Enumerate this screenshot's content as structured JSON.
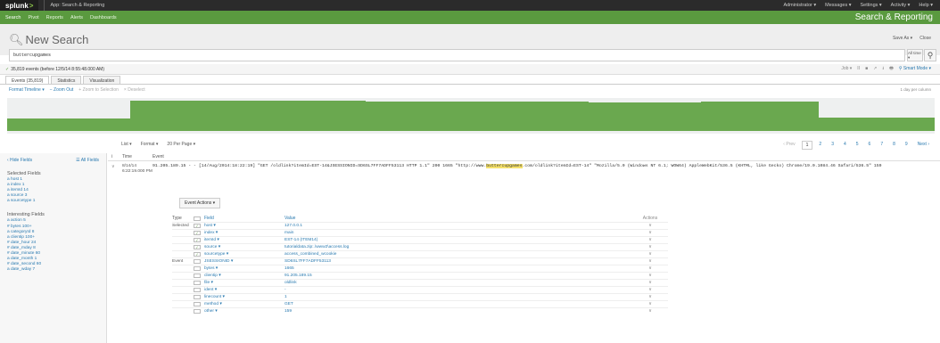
{
  "topbar": {
    "logo": "splunk",
    "app_name": "App: Search & Reporting",
    "right_items": [
      "Administrator ▾",
      "Messages ▾",
      "Settings ▾",
      "Activity ▾",
      "Help ▾"
    ]
  },
  "nav": {
    "items": [
      "Search",
      "Pivot",
      "Reports",
      "Alerts",
      "Dashboards"
    ],
    "title": "Search & Reporting"
  },
  "page": {
    "title": "New Search",
    "buttons": [
      "Save As ▾",
      "Close"
    ]
  },
  "search": {
    "query": "buttercupgames",
    "time_picker": "All time ▾"
  },
  "status": {
    "text": "35,819 events (before 12/5/14 8:55:48.000 AM)",
    "right": [
      "Job ▾",
      "II",
      "■",
      "↗",
      "⭳",
      "🖶"
    ],
    "mode": "⚲ Smart Mode ▾"
  },
  "tabs": [
    "Events (35,819)",
    "Statistics",
    "Visualization"
  ],
  "timeline_tools": {
    "format": "Format Timeline ▾",
    "zoom_out": "− Zoom Out",
    "zoom_sel": "+ Zoom to Selection",
    "deselect": "× Deselect",
    "scale": "1 day per column"
  },
  "list_options": [
    "List ▾",
    "Format ▾",
    "20 Per Page ▾"
  ],
  "pagination": {
    "prev": "‹ Prev",
    "pages": [
      "1",
      "2",
      "3",
      "4",
      "5",
      "6",
      "7",
      "8",
      "9"
    ],
    "next": "Next ›"
  },
  "sidebar": {
    "hide": "‹ Hide Fields",
    "all": "☰ All Fields",
    "selected_title": "Selected Fields",
    "selected": [
      "a host 1",
      "a index 1",
      "a itemId 14",
      "a source 3",
      "a sourcetype 1"
    ],
    "interesting_title": "Interesting Fields",
    "interesting": [
      "a action 5",
      "# bytes 100+",
      "a categoryId 8",
      "a clientip 100+",
      "# date_hour 24",
      "# date_mday 8",
      "# date_minute 60",
      "a date_month 1",
      "# date_second 60",
      "a date_wday 7"
    ]
  },
  "results": {
    "col_i": "i",
    "col_time": "Time",
    "col_event": "Event",
    "time_date": "8/14/14",
    "time_clock": "6:22:19.000 PM",
    "raw_pre": "91.205.189.15 - - [14/Aug/2014:18:22:19] \"GET /oldlink?itemId=EST-14&JSESSIONID=SD6SL7FF7ADFF53113 HTTP 1.1\" 200 1665 \"http://www.",
    "raw_hl": "buttercupgames",
    "raw_post": ".com/oldlink?itemId=EST-14\" \"Mozilla/5.0 (Windows NT 6.1; WOW64) AppleWebKit/536.5 (KHTML, like Gecko) Chrome/19.0.1084.46 Safari/536.5\" 159",
    "event_actions": "Event Actions ▾",
    "fh_type": "Type",
    "fh_field": "Field",
    "fh_value": "Value",
    "fh_actions": "Actions",
    "fields": [
      {
        "type": "Selected",
        "checked": true,
        "field": "host ▾",
        "value": "127.0.0.1"
      },
      {
        "type": "",
        "checked": true,
        "field": "index ▾",
        "value": "main"
      },
      {
        "type": "",
        "checked": true,
        "field": "itemId ▾",
        "value": "EST-14 (ITEM14)"
      },
      {
        "type": "",
        "checked": true,
        "field": "source ▾",
        "value": "tutorialdata.zip:.\\www2\\access.log"
      },
      {
        "type": "",
        "checked": true,
        "field": "sourcetype ▾",
        "value": "access_combined_wcookie"
      },
      {
        "type": "Event",
        "checked": false,
        "field": "JSESSIONID ▾",
        "value": "SD6SL7FF7ADFF53113"
      },
      {
        "type": "",
        "checked": false,
        "field": "bytes ▾",
        "value": "1665"
      },
      {
        "type": "",
        "checked": false,
        "field": "clientip ▾",
        "value": "91.205.189.15"
      },
      {
        "type": "",
        "checked": false,
        "field": "file ▾",
        "value": "oldlink"
      },
      {
        "type": "",
        "checked": false,
        "field": "ident ▾",
        "value": "-"
      },
      {
        "type": "",
        "checked": false,
        "field": "linecount ▾",
        "value": "1"
      },
      {
        "type": "",
        "checked": false,
        "field": "method ▾",
        "value": "GET"
      },
      {
        "type": "",
        "checked": false,
        "field": "other ▾",
        "value": "159"
      }
    ]
  }
}
